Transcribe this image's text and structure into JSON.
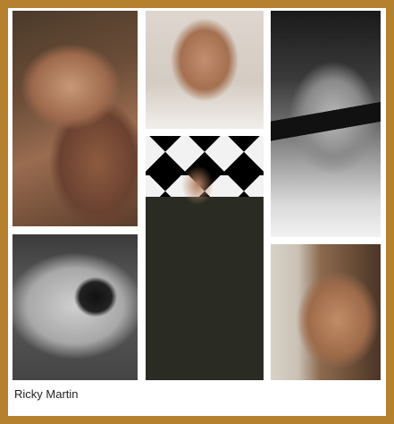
{
  "caption": "Ricky Martin",
  "colors": {
    "frame": "#b5812e",
    "background": "#ffffff",
    "caption_text": "#222222"
  },
  "photos": [
    "photo-hand-over-face",
    "photo-finger-on-lips",
    "photo-blindfold-bw",
    "photo-ring-hand-bw",
    "photo-stage-performance",
    "photo-close-up-face"
  ]
}
